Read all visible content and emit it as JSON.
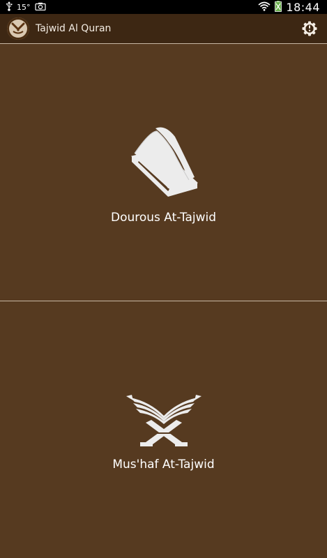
{
  "status_bar": {
    "temperature": "15°",
    "time": "18:44",
    "icons": [
      "usb-icon",
      "camera-icon",
      "wifi-icon",
      "battery-icon"
    ]
  },
  "action_bar": {
    "app_title": "Tajwid Al Quran",
    "logo_icon": "tajwid-logo-icon",
    "settings_icon": "settings-gear-icon"
  },
  "panels": [
    {
      "label": "Dourous At-Tajwid",
      "icon": "book-icon"
    },
    {
      "label": "Mus'haf At-Tajwid",
      "icon": "quran-stand-icon"
    }
  ],
  "colors": {
    "background": "#563a20",
    "action_bar": "#3d2713",
    "divider": "#c9b7a4",
    "text": "#ffffff"
  }
}
